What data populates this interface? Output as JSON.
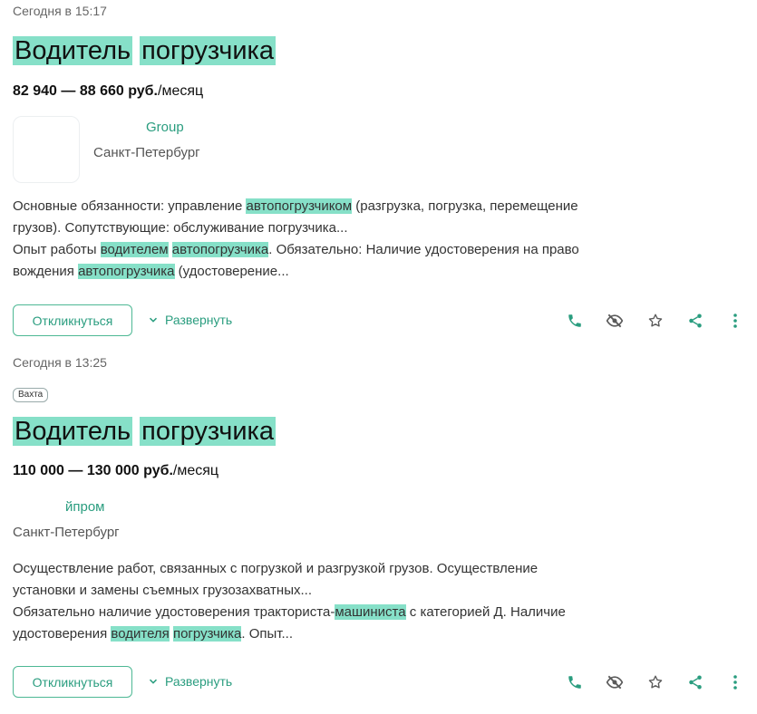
{
  "vacancies": [
    {
      "date": "Сегодня в 15:17",
      "badge": "",
      "title": [
        "Водитель",
        "погрузчика"
      ],
      "salary_range": "82 940 — 88 660 руб.",
      "salary_unit": "/месяц",
      "company": "Group",
      "city": "Санкт-Петербург",
      "desc_line1": [
        {
          "t": "Основные обязанности: управление ",
          "h": false
        },
        {
          "t": "автопогрузчиком",
          "h": true
        },
        {
          "t": " (разгрузка, погрузка, перемещение грузов). Сопутствующие: обслуживание погрузчика...",
          "h": false
        }
      ],
      "desc_line2": [
        {
          "t": "Опыт работы ",
          "h": false
        },
        {
          "t": "водителем",
          "h": true
        },
        {
          "t": " ",
          "h": false
        },
        {
          "t": "автопогрузчика",
          "h": true
        },
        {
          "t": ". Обязательно: Наличие удостоверения на право вождения ",
          "h": false
        },
        {
          "t": "автопогрузчика",
          "h": true
        },
        {
          "t": " (удостоверение...",
          "h": false
        }
      ],
      "respond_label": "Откликнуться",
      "expand_label": "Развернуть"
    },
    {
      "date": "Сегодня в 13:25",
      "badge": "Вахта",
      "title": [
        "Водитель",
        "погрузчика"
      ],
      "salary_range": "110 000 — 130 000 руб.",
      "salary_unit": "/месяц",
      "company": "йпром",
      "city": "Санкт-Петербург",
      "desc_line1": [
        {
          "t": "Осуществление работ, связанных с погрузкой и разгрузкой грузов. Осуществление установки и замены съемных грузозахватных...",
          "h": false
        }
      ],
      "desc_line2": [
        {
          "t": "Обязательно наличие удостоверения тракториста-",
          "h": false
        },
        {
          "t": "машиниста",
          "h": true
        },
        {
          "t": " с категорией Д. Наличие удостоверения ",
          "h": false
        },
        {
          "t": "водителя",
          "h": true
        },
        {
          "t": " ",
          "h": false
        },
        {
          "t": "погрузчика",
          "h": true
        },
        {
          "t": ". Опыт...",
          "h": false
        }
      ],
      "respond_label": "Откликнуться",
      "expand_label": "Развернуть"
    }
  ],
  "icons": {
    "action_icons": [
      "phone-icon",
      "hide-eye-icon",
      "star-icon",
      "share-icon",
      "more-vertical-icon"
    ],
    "expand_icon": "chevron-down-icon"
  },
  "colors": {
    "accent": "#2a9d7f",
    "highlight": "#86e0c8",
    "icon": "#5a5a5a",
    "border": "#4db894"
  }
}
